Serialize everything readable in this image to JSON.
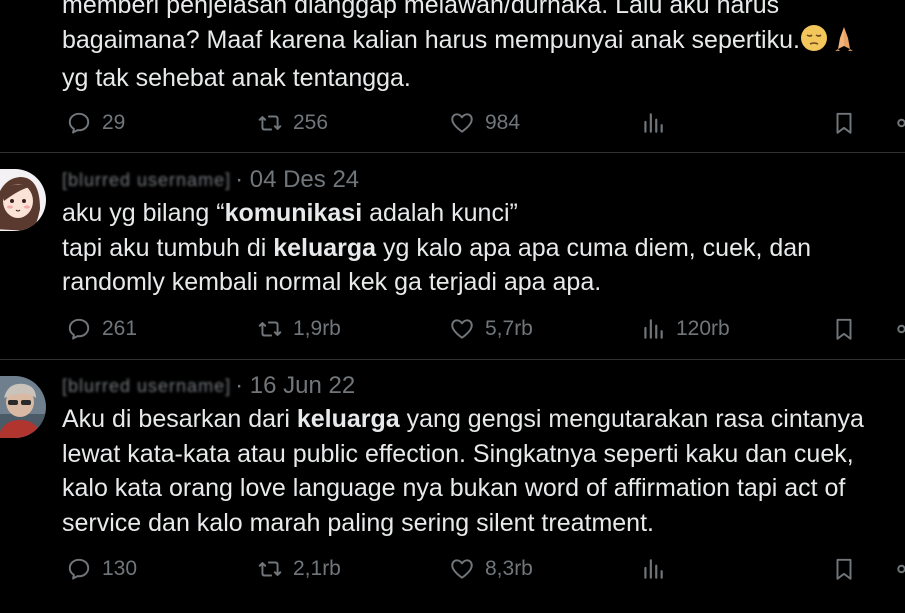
{
  "tweets": [
    {
      "lines": [
        "memberi penjelasan dianggap melawan/durhaka. Lalu aku harus",
        "bagaimana? Maaf karena kalian harus mempunyai anak sepertiku.",
        " yg tak sehebat anak tentangga."
      ],
      "emoji": [
        "pensive-face",
        "folded-hands"
      ],
      "stats": {
        "replies": "29",
        "reposts": "256",
        "likes": "984",
        "views": ""
      }
    },
    {
      "handle": "[blurred username]",
      "date": "· 04 Des 24",
      "lines": [
        [
          "aku yg bilang “",
          "komunikasi",
          " adalah kunci”"
        ],
        [
          "tapi aku tumbuh di ",
          "keluarga",
          " yg kalo apa apa cuma diem, cuek, dan"
        ],
        [
          "randomly kembali normal kek ga terjadi apa apa.",
          "",
          ""
        ]
      ],
      "stats": {
        "replies": "261",
        "reposts": "1,9rb",
        "likes": "5,7rb",
        "views": "120rb"
      }
    },
    {
      "handle": "[blurred username]",
      "date": "· 16 Jun 22",
      "lines": [
        [
          "Aku di besarkan dari ",
          "keluarga",
          " yang gengsi mengutarakan rasa cintanya"
        ],
        [
          "lewat kata-kata atau public effection. Singkatnya seperti kaku dan cuek,",
          "",
          ""
        ],
        [
          "kalo kata orang love language nya bukan word of affirmation tapi act of",
          "",
          ""
        ],
        [
          "service dan kalo marah paling sering silent treatment.",
          "",
          ""
        ]
      ],
      "stats": {
        "replies": "130",
        "reposts": "2,1rb",
        "likes": "8,3rb",
        "views": ""
      }
    }
  ],
  "colors": {
    "background": "#000000",
    "text": "#e7e9ea",
    "muted": "#71767b",
    "divider": "#2f3336"
  },
  "icons": [
    "reply-icon",
    "repost-icon",
    "like-icon",
    "views-icon",
    "bookmark-icon",
    "share-icon"
  ]
}
